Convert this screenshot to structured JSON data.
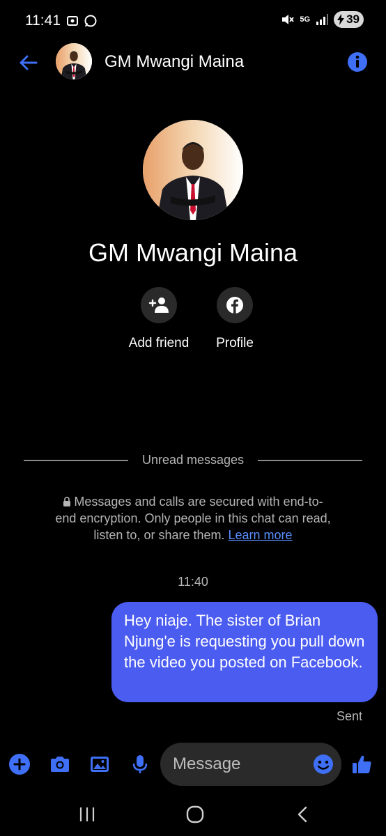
{
  "status_bar": {
    "time": "11:41",
    "battery": "39",
    "network": "5G"
  },
  "header": {
    "contact_name": "GM Mwangi Maina"
  },
  "profile": {
    "name": "GM Mwangi Maina",
    "actions": [
      {
        "label": "Add friend",
        "icon": "add-person-icon"
      },
      {
        "label": "Profile",
        "icon": "facebook-icon"
      }
    ]
  },
  "chat": {
    "divider_label": "Unread messages",
    "encryption_notice": "Messages and calls are secured with end-to-end encryption. Only people in this chat can read, listen to, or share them.",
    "learn_more": "Learn more",
    "timestamp": "11:40",
    "messages": [
      {
        "text": "Hey niaje. The sister of Brian Njung'e is requesting you pull down the video you posted on Facebook.",
        "status": "Sent"
      }
    ]
  },
  "composer": {
    "placeholder": "Message"
  },
  "colors": {
    "accent": "#4b5cf1",
    "icon_blue": "#3f6ff5",
    "link": "#5a8eff",
    "background": "#000000"
  }
}
